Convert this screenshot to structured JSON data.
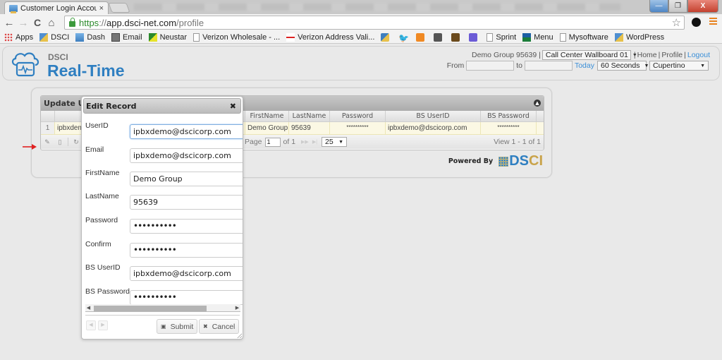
{
  "browser": {
    "tab_title": "Customer Login Accounts",
    "tab_close": "×",
    "url_scheme": "https",
    "url_sep": "://",
    "url_host": "app.dsci-net.com",
    "url_path": "/profile",
    "window_controls": {
      "minimize": "—",
      "maximize": "❐",
      "close": "X"
    },
    "nav": {
      "back": "←",
      "forward": "→",
      "reload": "C",
      "home": "⌂"
    },
    "star": "☆",
    "bookmarks": [
      {
        "label": "Apps",
        "icon": "apps-icon"
      },
      {
        "label": "DSCI",
        "icon": "dsci-icon"
      },
      {
        "label": "Dash",
        "icon": "dash-icon"
      },
      {
        "label": "Email",
        "icon": "email-icon"
      },
      {
        "label": "Neustar",
        "icon": "neustar-icon"
      },
      {
        "label": "Verizon Wholesale - ...",
        "icon": "page-icon"
      },
      {
        "label": "Verizon Address Vali...",
        "icon": "verizon-icon"
      },
      {
        "label": "",
        "icon": "bookmark-icon"
      },
      {
        "label": "",
        "icon": "twitter-icon"
      },
      {
        "label": "",
        "icon": "chart-icon"
      },
      {
        "label": "",
        "icon": "bookmark-icon"
      },
      {
        "label": "",
        "icon": "ups-icon"
      },
      {
        "label": "",
        "icon": "signal-icon"
      },
      {
        "label": "Sprint",
        "icon": "page-icon"
      },
      {
        "label": "Menu",
        "icon": "menu-bookmark-icon"
      },
      {
        "label": "Mysoftware",
        "icon": "page-icon"
      },
      {
        "label": "WordPress",
        "icon": "wordpress-icon"
      }
    ]
  },
  "header": {
    "brand_small": "DSCI",
    "brand_big": "Real-Time",
    "user": "Demo Group 95639 |",
    "wallboard_select": "Call Center Wallboard 01",
    "sep": "|",
    "home_link": "Home",
    "profile_link": "Profile",
    "logout_link": "Logout",
    "from_label": "From",
    "from_value": "",
    "to_label": "to",
    "to_value": "",
    "today_link": "Today",
    "interval_select": "60 Seconds",
    "location_select": "Cupertino",
    "caret": "▼"
  },
  "grid": {
    "title": "Update Us",
    "collapse_icon": "▲",
    "columns": [
      "",
      "",
      "FirstName",
      "LastName",
      "Password",
      "BS UserID",
      "BS Password"
    ],
    "rows": [
      {
        "num": "1",
        "userid": "ipbxdem",
        "firstname": "Demo Group",
        "lastname": "95639",
        "password": "**********",
        "bs_userid": "ipbxdemo@dscicorp.com",
        "bs_password": "**********"
      }
    ],
    "pager": {
      "page_label": "Page",
      "page_value": "1",
      "of_label": "of 1",
      "next": "▶▶",
      "last": "▶|",
      "page_size": "25",
      "view_text": "View 1 - 1 of 1"
    }
  },
  "powered_by": {
    "label": "Powered By",
    "logo_part1": "DS",
    "logo_part2": "CI"
  },
  "modal": {
    "title": "Edit Record",
    "close": "✖",
    "fields": [
      {
        "label": "UserID",
        "value": "ipbxdemo@dscicorp.com",
        "type": "text"
      },
      {
        "label": "Email",
        "value": "ipbxdemo@dscicorp.com",
        "type": "text"
      },
      {
        "label": "FirstName",
        "value": "Demo Group",
        "type": "text"
      },
      {
        "label": "LastName",
        "value": "95639",
        "type": "text"
      },
      {
        "label": "Password",
        "value": "••••••••••",
        "type": "password"
      },
      {
        "label": "Confirm",
        "value": "••••••••••",
        "type": "password"
      },
      {
        "label": "BS UserID",
        "value": "ipbxdemo@dscicorp.com",
        "type": "text"
      },
      {
        "label": "BS Password",
        "value": "••••••••••",
        "type": "password"
      }
    ],
    "prev": "◀",
    "next": "▶",
    "submit_label": "Submit",
    "submit_icon": "▣",
    "cancel_label": "Cancel",
    "cancel_icon": "✖",
    "scroll_left": "◀",
    "scroll_right": "▶"
  }
}
